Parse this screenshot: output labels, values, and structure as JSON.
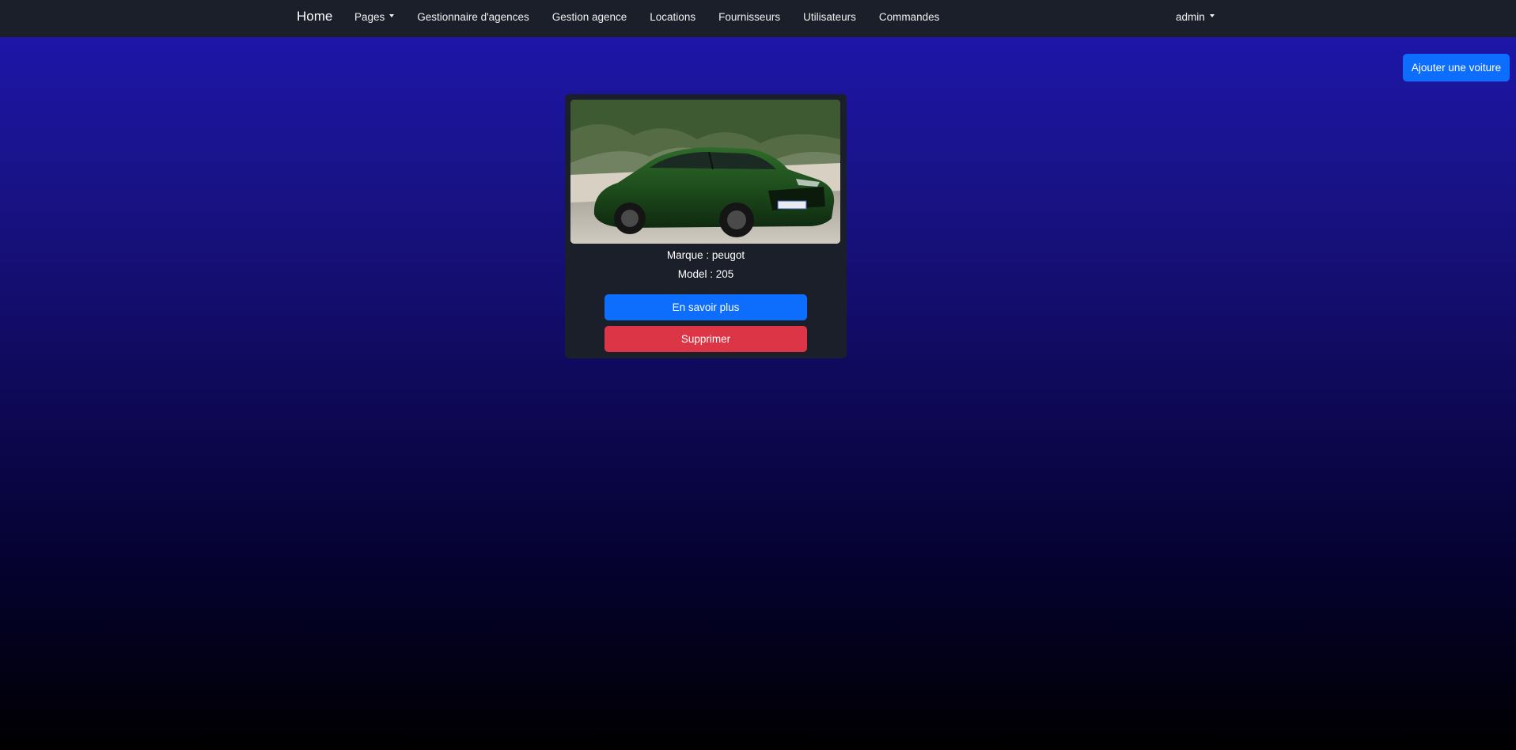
{
  "navbar": {
    "brand": "Home",
    "links": [
      {
        "label": "Pages",
        "dropdown": true
      },
      {
        "label": "Gestionnaire d'agences"
      },
      {
        "label": "Gestion agence"
      },
      {
        "label": "Locations"
      },
      {
        "label": "Fournisseurs"
      },
      {
        "label": "Utilisateurs"
      },
      {
        "label": "Commandes"
      }
    ],
    "user": "admin"
  },
  "actions": {
    "add_car": "Ajouter une voiture"
  },
  "car_card": {
    "image_icon": "car-photo",
    "brand_text": "Marque : peugot",
    "model_text": "Model : 205",
    "details_button": "En savoir plus",
    "delete_button": "Supprimer"
  },
  "colors": {
    "navbar_bg": "#1b1f29",
    "primary": "#0d6efd",
    "danger": "#dc3545",
    "background_top": "#1e16b0",
    "background_bottom": "#000000"
  }
}
